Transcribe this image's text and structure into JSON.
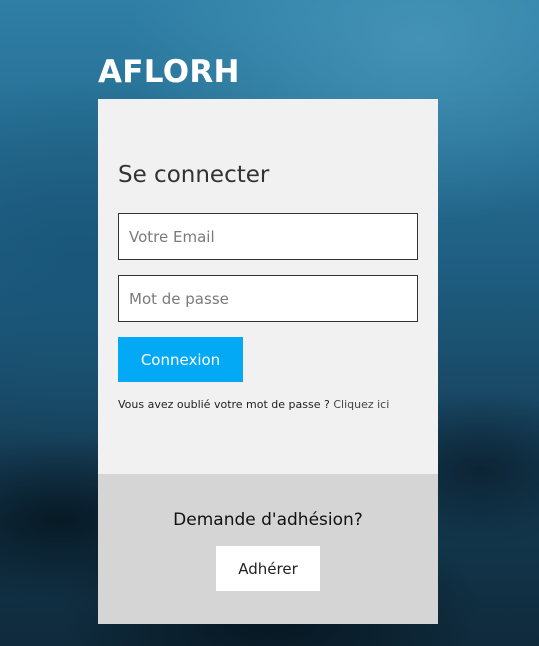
{
  "brand": {
    "name": "AFLORH"
  },
  "login": {
    "title": "Se connecter",
    "email_placeholder": "Votre Email",
    "email_value": "",
    "password_placeholder": "Mot de passe",
    "password_value": "",
    "submit_label": "Connexion",
    "forgot_text": "Vous avez oublié votre mot de passe ?",
    "forgot_link_label": "Cliquez ici"
  },
  "join": {
    "title": "Demande d'adhésion?",
    "button_label": "Adhérer"
  },
  "colors": {
    "accent": "#03a9f4",
    "login_panel_bg": "#f1f1f1",
    "join_panel_bg": "#d5d5d5"
  }
}
